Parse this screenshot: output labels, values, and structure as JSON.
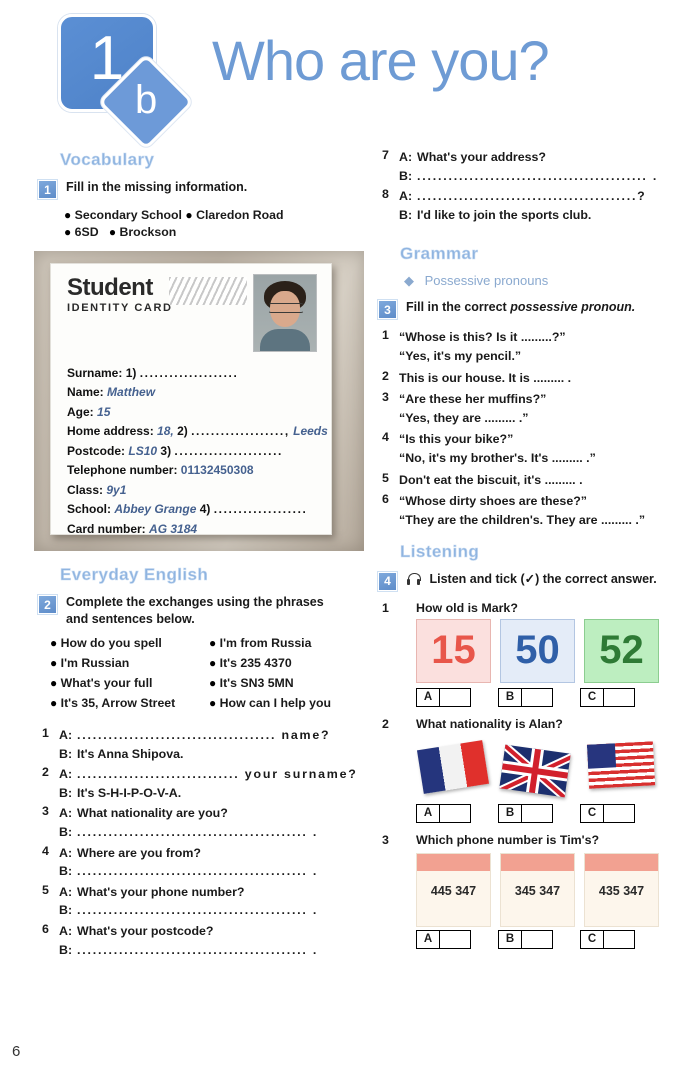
{
  "header": {
    "unit_number": "1",
    "unit_letter": "b",
    "title": "Who are you?"
  },
  "page_number": "6",
  "left_column": {
    "vocabulary": {
      "heading": "Vocabulary",
      "exercise_number": "1",
      "instruction": "Fill in the missing information.",
      "wordbank": [
        [
          "Secondary School",
          "Claredon Road"
        ],
        [
          "6SD",
          "Brockson"
        ]
      ],
      "id_card": {
        "title": "Student",
        "subtitle": "IDENTITY CARD",
        "photo_alt": "student-photo",
        "fields": [
          {
            "label": "Surname:",
            "marker": "1)",
            "value": "",
            "dots": "...................."
          },
          {
            "label": "Name:",
            "marker": "",
            "value": "Matthew",
            "dots": ""
          },
          {
            "label": "Age:",
            "marker": "",
            "value": "15",
            "dots": ""
          },
          {
            "label": "Home address:",
            "marker": "2)",
            "value": "18,",
            "dots": "...................,",
            "suffix": "Leeds"
          },
          {
            "label": "Postcode:",
            "marker": "3)",
            "value": "LS10",
            "dots": "......................"
          },
          {
            "label": "Telephone number:",
            "marker": "",
            "value": "01132450308",
            "dots": ""
          },
          {
            "label": "Class:",
            "marker": "",
            "value": "9y1",
            "dots": ""
          },
          {
            "label": "School:",
            "marker": "4)",
            "value": "Abbey Grange",
            "dots": "..................."
          },
          {
            "label": "Card number:",
            "marker": "",
            "value": "AG 3184",
            "dots": ""
          }
        ]
      }
    },
    "everyday_english": {
      "heading": "Everyday English",
      "exercise_number": "2",
      "instruction_line1": "Complete the exchanges using the phrases",
      "instruction_line2": "and sentences below.",
      "phrases_left": [
        "How do you spell",
        "I'm Russian",
        "What's your full",
        "It's 35, Arrow Street"
      ],
      "phrases_right": [
        "I'm from Russia",
        "It's 235 4370",
        "It's SN3 5MN",
        "How can I help you"
      ],
      "exchanges": [
        {
          "n": "1",
          "a": "...................................... name?",
          "b": "It's Anna Shipova."
        },
        {
          "n": "2",
          "a": "............................... your surname?",
          "b": "It's S-H-I-P-O-V-A."
        },
        {
          "n": "3",
          "a": "What nationality are you?",
          "b": "............................................ ."
        },
        {
          "n": "4",
          "a": "Where are you from?",
          "b": "............................................ ."
        },
        {
          "n": "5",
          "a": "What's your phone number?",
          "b": "............................................ ."
        },
        {
          "n": "6",
          "a": "What's your postcode?",
          "b": "............................................ ."
        }
      ]
    }
  },
  "right_column": {
    "exchanges_continued": [
      {
        "n": "7",
        "a": "What's your address?",
        "b": "............................................ ."
      },
      {
        "n": "8",
        "a": "..........................................?",
        "b": "I'd like to join the sports club."
      }
    ],
    "grammar": {
      "heading": "Grammar",
      "bullet_label": "Possessive pronouns",
      "exercise_number": "3",
      "instruction_plain": "Fill in the correct ",
      "instruction_italic": "possessive pronoun.",
      "items": [
        {
          "n": "1",
          "line1": "“Whose is this? Is it .........?”",
          "line2": "“Yes, it's my pencil.”"
        },
        {
          "n": "2",
          "line1": "This is our house. It is ......... .",
          "line2": ""
        },
        {
          "n": "3",
          "line1": "“Are these her muffins?”",
          "line2": "“Yes, they are ......... .”"
        },
        {
          "n": "4",
          "line1": "“Is this your bike?”",
          "line2": "“No, it's my brother's. It's ......... .”"
        },
        {
          "n": "5",
          "line1": "Don't eat the biscuit, it's ......... .",
          "line2": ""
        },
        {
          "n": "6",
          "line1": "“Whose dirty shoes are these?”",
          "line2": "“They are the children's. They are ......... .”"
        }
      ]
    },
    "listening": {
      "heading": "Listening",
      "exercise_number": "4",
      "icon": "headphones-icon",
      "instruction": "Listen and tick (✓) the correct answer.",
      "questions": [
        {
          "n": "1",
          "text": "How old is Mark?",
          "type": "numbers",
          "options": [
            {
              "letter": "A",
              "value": "15",
              "color": "#e8564a",
              "bg": "#fbe0de"
            },
            {
              "letter": "B",
              "value": "50",
              "color": "#2f5fa8",
              "bg": "#e4ecf8"
            },
            {
              "letter": "C",
              "value": "52",
              "color": "#2e7a35",
              "bg": "#bdeec0"
            }
          ]
        },
        {
          "n": "2",
          "text": "What nationality is Alan?",
          "type": "flags",
          "options": [
            {
              "letter": "A",
              "value": "france-flag"
            },
            {
              "letter": "B",
              "value": "uk-flag"
            },
            {
              "letter": "C",
              "value": "usa-flag"
            }
          ]
        },
        {
          "n": "3",
          "text": "Which phone number is Tim's?",
          "type": "phone-cards",
          "options": [
            {
              "letter": "A",
              "value": "445 347"
            },
            {
              "letter": "B",
              "value": "345 347"
            },
            {
              "letter": "C",
              "value": "435 347"
            }
          ]
        }
      ]
    }
  }
}
